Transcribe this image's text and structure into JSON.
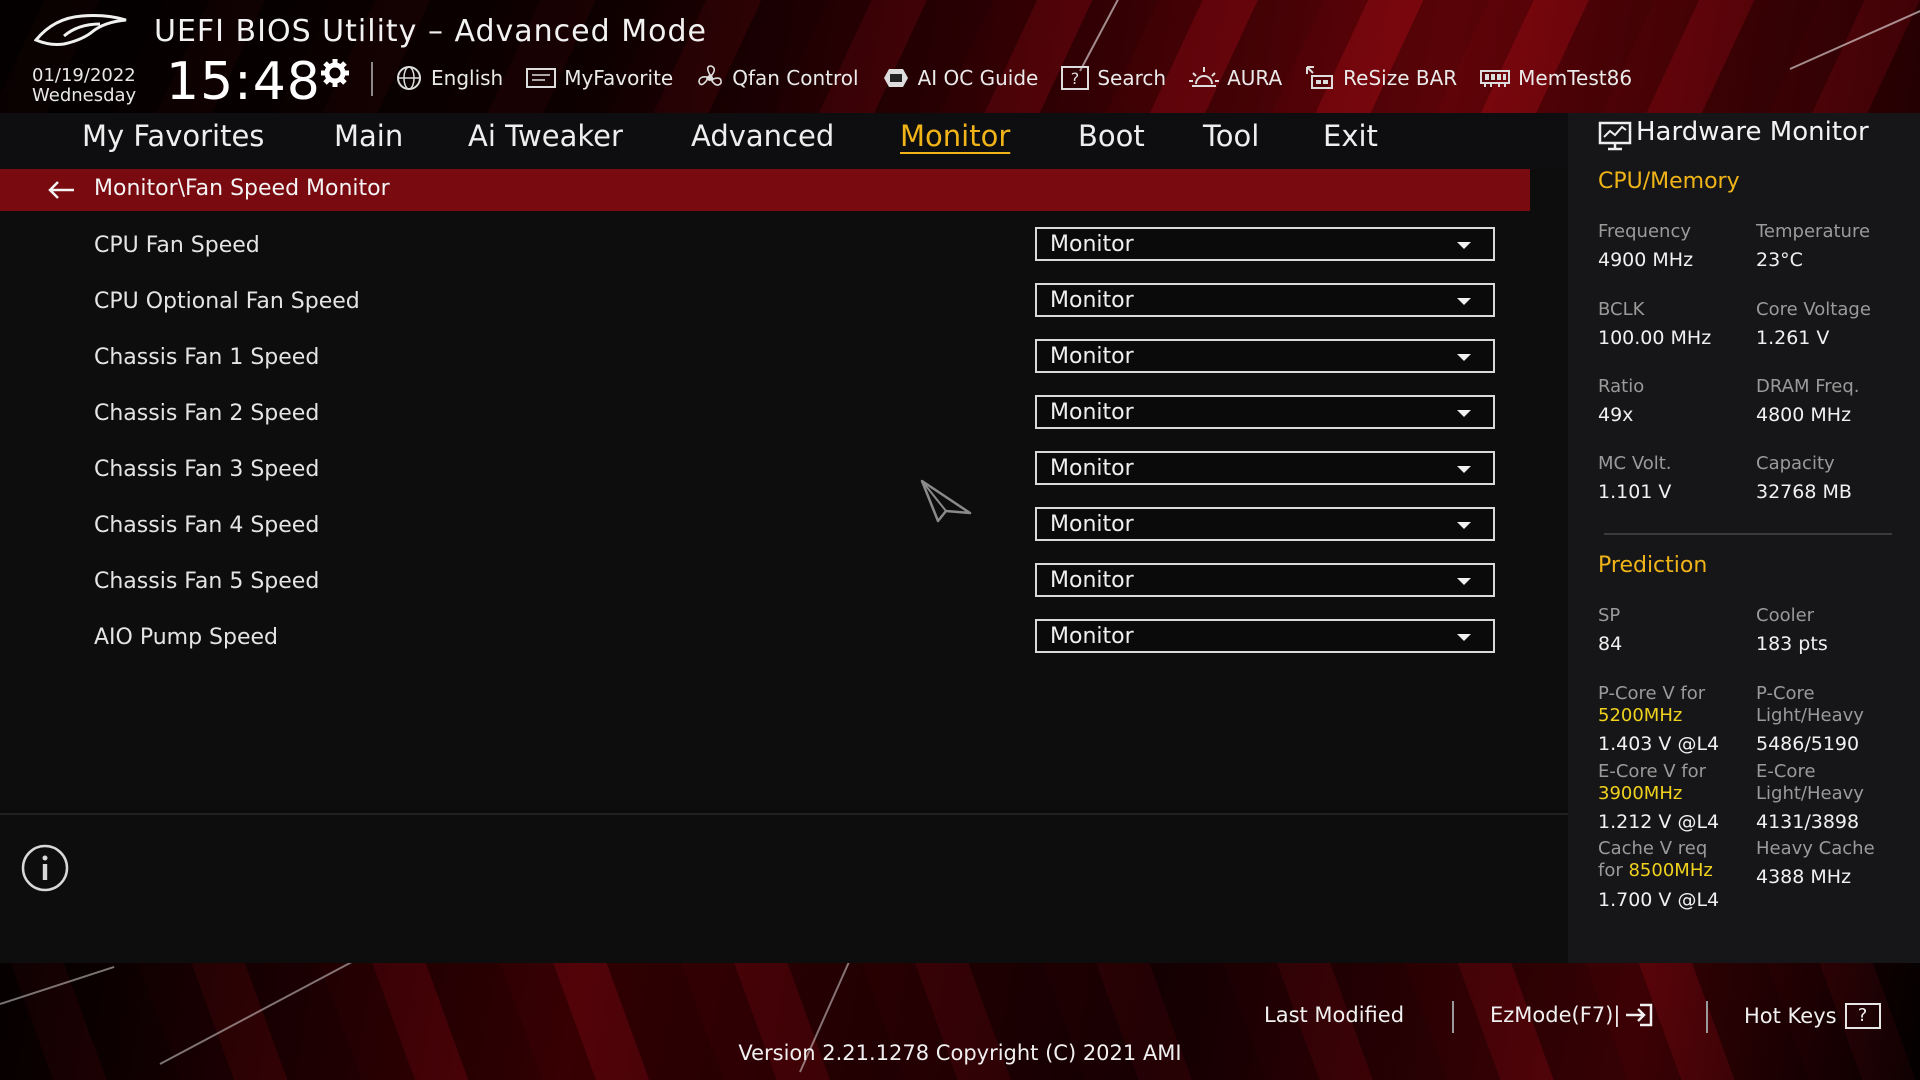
{
  "header": {
    "title": "UEFI BIOS Utility – Advanced Mode",
    "date": "01/19/2022",
    "weekday": "Wednesday",
    "time": "15:48",
    "toolbar": [
      {
        "label": "English",
        "icon": "globe-icon"
      },
      {
        "label": "MyFavorite",
        "icon": "favorite-icon"
      },
      {
        "label": "Qfan Control",
        "icon": "fan-icon"
      },
      {
        "label": "AI OC Guide",
        "icon": "ai-oc-icon"
      },
      {
        "label": "Search",
        "icon": "search-help-icon"
      },
      {
        "label": "AURA",
        "icon": "aura-icon"
      },
      {
        "label": "ReSize BAR",
        "icon": "resize-bar-icon"
      },
      {
        "label": "MemTest86",
        "icon": "memtest-icon"
      }
    ]
  },
  "nav": {
    "tabs": [
      {
        "label": "My Favorites"
      },
      {
        "label": "Main"
      },
      {
        "label": "Ai Tweaker"
      },
      {
        "label": "Advanced"
      },
      {
        "label": "Monitor",
        "active": true
      },
      {
        "label": "Boot"
      },
      {
        "label": "Tool"
      },
      {
        "label": "Exit"
      }
    ]
  },
  "content": {
    "breadcrumb": "Monitor\\Fan Speed Monitor",
    "settings": [
      {
        "label": "CPU Fan Speed",
        "value": "Monitor"
      },
      {
        "label": "CPU Optional Fan Speed",
        "value": "Monitor"
      },
      {
        "label": "Chassis Fan 1 Speed",
        "value": "Monitor"
      },
      {
        "label": "Chassis Fan 2 Speed",
        "value": "Monitor"
      },
      {
        "label": "Chassis Fan 3 Speed",
        "value": "Monitor"
      },
      {
        "label": "Chassis Fan 4 Speed",
        "value": "Monitor"
      },
      {
        "label": "Chassis Fan 5 Speed",
        "value": "Monitor"
      },
      {
        "label": "AIO Pump Speed",
        "value": "Monitor"
      }
    ]
  },
  "hw": {
    "title": "Hardware Monitor",
    "cpu_memory": {
      "heading": "CPU/Memory",
      "frequency_label": "Frequency",
      "frequency": "4900 MHz",
      "temperature_label": "Temperature",
      "temperature": "23°C",
      "bclk_label": "BCLK",
      "bclk": "100.00 MHz",
      "core_voltage_label": "Core Voltage",
      "core_voltage": "1.261 V",
      "ratio_label": "Ratio",
      "ratio": "49x",
      "dram_label": "DRAM Freq.",
      "dram": "4800 MHz",
      "mc_volt_label": "MC Volt.",
      "mc_volt": "1.101 V",
      "capacity_label": "Capacity",
      "capacity": "32768 MB"
    },
    "prediction": {
      "heading": "Prediction",
      "sp_label": "SP",
      "sp": "84",
      "cooler_label": "Cooler",
      "cooler": "183 pts",
      "pcore_v_label": "P-Core V for",
      "pcore_v_freq": "5200MHz",
      "pcore_v": "1.403 V @L4",
      "pcore_lh_label_1": "P-Core",
      "pcore_lh_label_2": "Light/Heavy",
      "pcore_lh": "5486/5190",
      "ecore_v_label": "E-Core V for",
      "ecore_v_freq": "3900MHz",
      "ecore_v": "1.212 V @L4",
      "ecore_lh_label_1": "E-Core",
      "ecore_lh_label_2": "Light/Heavy",
      "ecore_lh": "4131/3898",
      "cache_v_label_1": "Cache V req",
      "cache_v_label_2": "for",
      "cache_v_freq": "8500MHz",
      "cache_v": "1.700 V @L4",
      "heavy_cache_label": "Heavy Cache",
      "heavy_cache": "4388 MHz"
    }
  },
  "footer": {
    "last_modified": "Last Modified",
    "ezmode": "EzMode(F7)|",
    "hotkeys": "Hot Keys",
    "hotkeys_key": "?",
    "version": "Version 2.21.1278 Copyright (C) 2021 AMI"
  },
  "colors": {
    "accent": "#f0b418",
    "highlight": "#f0d21e",
    "breadcrumb_bar": "#780a10"
  }
}
